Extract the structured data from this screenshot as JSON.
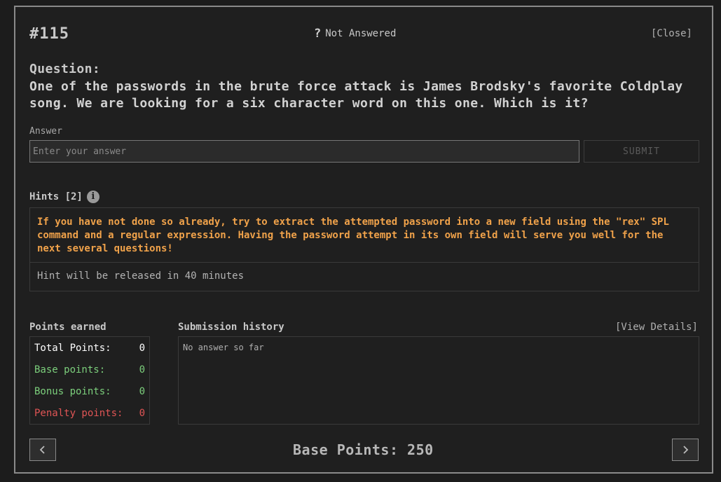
{
  "header": {
    "question_number": "#115",
    "status_icon": "question-mark-icon",
    "status_text": "Not Answered",
    "close_label": "[Close]"
  },
  "question": {
    "label": "Question:",
    "text": "One of the passwords in the brute force attack is James Brodsky's favorite Coldplay song. We are looking for a six character word on this one. Which is it?"
  },
  "answer": {
    "label": "Answer",
    "value": "",
    "placeholder": "Enter your answer",
    "submit_label": "SUBMIT"
  },
  "hints": {
    "title": "Hints [2]",
    "info_icon": "info-icon",
    "items": [
      {
        "text": "If you have not done so already, try to extract the attempted password into a new field using the \"rex\" SPL command and a regular expression. Having the password attempt in its own field will serve you well for the next several questions!"
      },
      {
        "text": "Hint will be released in 40 minutes"
      }
    ]
  },
  "points": {
    "title": "Points earned",
    "rows": [
      {
        "label": "Total Points:",
        "value": "0"
      },
      {
        "label": "Base points:",
        "value": "0"
      },
      {
        "label": "Bonus points:",
        "value": "0"
      },
      {
        "label": "Penalty points:",
        "value": "0"
      }
    ]
  },
  "submissions": {
    "title": "Submission history",
    "view_details_label": "[View Details]",
    "empty_text": "No answer so far"
  },
  "footer": {
    "base_points_label": "Base Points: 250",
    "prev_icon": "chevron-left-icon",
    "next_icon": "chevron-right-icon"
  },
  "colors": {
    "hint_revealed": "#f0a24a",
    "base": "#7ccf7c",
    "bonus": "#7ccf7c",
    "penalty": "#e05555",
    "background": "#1f1f1f"
  }
}
